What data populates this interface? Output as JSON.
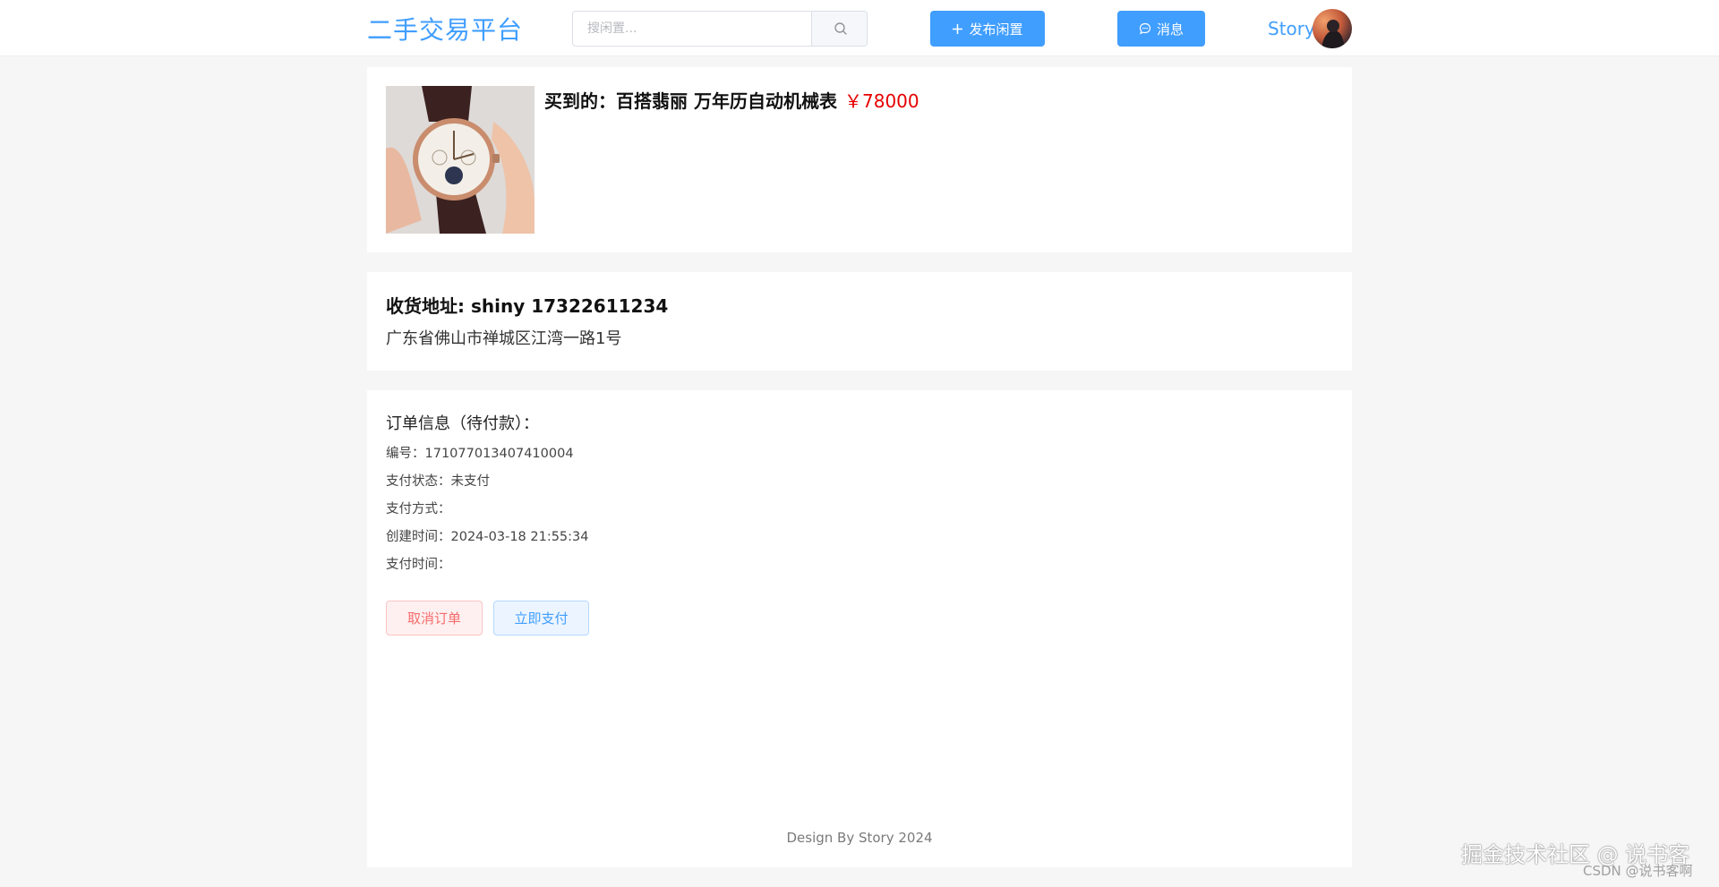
{
  "header": {
    "logo": "二手交易平台",
    "search_placeholder": "搜闲置...",
    "publish_label": "发布闲置",
    "message_label": "消息",
    "user_name": "Story"
  },
  "product": {
    "title": "买到的：百搭翡丽 万年历自动机械表",
    "price": "￥78000"
  },
  "address": {
    "heading": "收货地址: shiny 17322611234",
    "detail": "广东省佛山市禅城区江湾一路1号"
  },
  "order": {
    "title": "订单信息（待付款）：",
    "rows": [
      "编号：171077013407410004",
      "支付状态：未支付",
      "支付方式：",
      "创建时间：2024-03-18 21:55:34",
      "支付时间："
    ],
    "cancel_label": "取消订单",
    "pay_label": "立即支付"
  },
  "footer": {
    "text": "Design By Story 2024"
  },
  "watermark": {
    "main": "掘金技术社区 @ 说书客",
    "sub": "CSDN @说书客啊"
  },
  "colors": {
    "primary": "#409eff",
    "price": "#e60000",
    "danger": "#f56c6c",
    "page_bg": "#f6f6f6"
  },
  "icons": {
    "search": "search-icon",
    "plus": "plus-icon",
    "message": "message-icon"
  }
}
